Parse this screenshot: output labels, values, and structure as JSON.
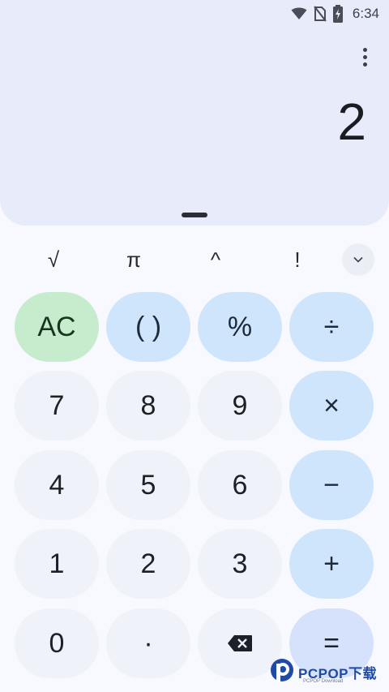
{
  "status_bar": {
    "time": "6:34",
    "icons": [
      "wifi-icon",
      "no-sim-icon",
      "battery-charging-icon"
    ]
  },
  "display": {
    "result": "2",
    "menu_icon": "overflow-menu-icon"
  },
  "scientific_row": {
    "keys": [
      "√",
      "π",
      "^",
      "!"
    ],
    "expand_icon": "chevron-down-icon"
  },
  "keypad": {
    "row1": [
      "AC",
      "( )",
      "%",
      "÷"
    ],
    "row2": [
      "7",
      "8",
      "9",
      "×"
    ],
    "row3": [
      "4",
      "5",
      "6",
      "−"
    ],
    "row4": [
      "1",
      "2",
      "3",
      "+"
    ],
    "row5": [
      "0",
      "·",
      "backspace-icon",
      "="
    ]
  },
  "colors": {
    "display_bg": "#e8ecfa",
    "operator_key": "#cfe5fb",
    "clear_key": "#c7ebcd",
    "number_key": "#f0f2f9"
  },
  "watermark": {
    "text": "PCPOP下载",
    "subtext": "PCPOP Download"
  }
}
